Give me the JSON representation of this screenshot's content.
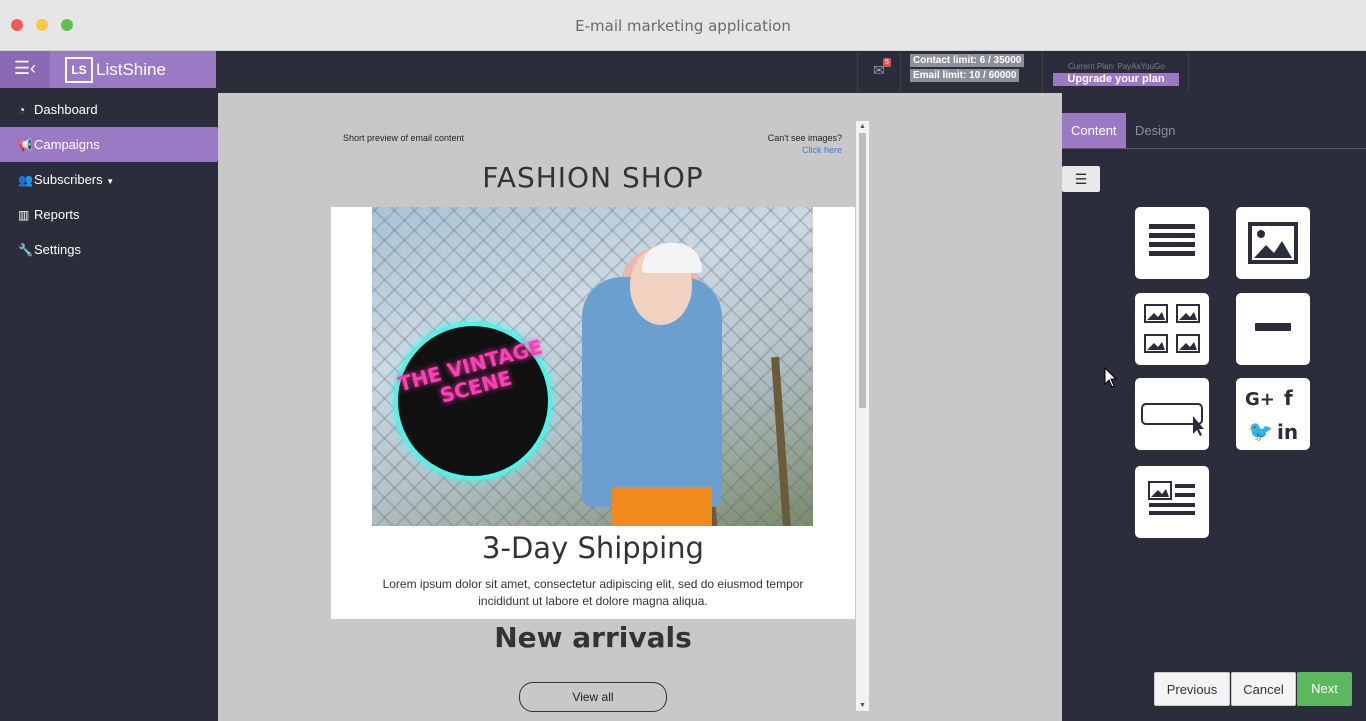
{
  "window": {
    "title": "E-mail marketing application"
  },
  "brand": {
    "logo": "LS",
    "name": "ListShine"
  },
  "sidebar": {
    "items": [
      {
        "label": "Dashboard",
        "icon": "dashboard-icon"
      },
      {
        "label": "Campaigns",
        "icon": "bullhorn-icon"
      },
      {
        "label": "Subscribers",
        "icon": "users-icon"
      },
      {
        "label": "Reports",
        "icon": "bar-chart-icon"
      },
      {
        "label": "Settings",
        "icon": "wrench-icon"
      }
    ],
    "active": "Campaigns"
  },
  "topbar": {
    "mail_badge": "5",
    "contact_limit": "Contact limit: 6 / 35000",
    "email_limit": "Email limit: 10 / 60000",
    "plan_label": "Current Plan: PayAsYouGo",
    "upgrade_label": "Upgrade your plan"
  },
  "email": {
    "preview_text": "Short preview of email content",
    "cant_see": "Can't see images?",
    "click_here": "Click here",
    "shop_title": "FASHION SHOP",
    "neon_text": "THE VINTAGE SCENE",
    "headline": "3-Day Shipping",
    "body": "Lorem ipsum dolor sit amet, consectetur adipiscing elit, sed do eiusmod tempor incididunt ut labore et dolore magna aliqua.",
    "section_title": "New arrivals",
    "button_label": "View all"
  },
  "panel": {
    "tabs": [
      "Content",
      "Design"
    ],
    "active_tab": "Content",
    "blocks": [
      "text-block",
      "image-block",
      "image-grid-block",
      "divider-block",
      "button-block",
      "social-block",
      "image-text-block"
    ]
  },
  "footer": {
    "previous": "Previous",
    "cancel": "Cancel",
    "next": "Next"
  },
  "colors": {
    "accent": "#9a7ac4",
    "dark": "#2b2d3a",
    "success": "#5cb85c"
  }
}
